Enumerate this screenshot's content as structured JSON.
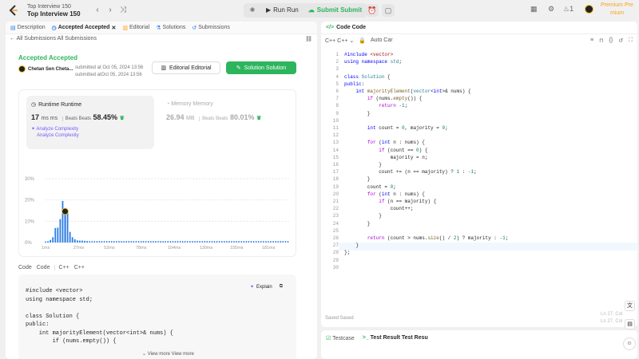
{
  "topbar": {
    "list_title": "Top Interview 150",
    "list_title2": "Top Interview 150",
    "run_label": "Run Run",
    "submit_label": "Submit Submit",
    "streak_count": "1",
    "premium_label": "Premium Pre",
    "premium_label2": "mium"
  },
  "left_tabs": [
    {
      "label": "Description"
    },
    {
      "label": "Accepted Accepted"
    },
    {
      "label": "Editorial"
    },
    {
      "label": "Solutions"
    },
    {
      "label": "Submissions"
    }
  ],
  "subbar": {
    "back_label": "All Submissions",
    "back_label2": "All Submissions"
  },
  "result": {
    "status": "Accepted Accepted",
    "author": "Chetan Sen Cheta...",
    "submitted_line1": "submitted at Oct 05, 2024 13:56",
    "submitted_line2": "submitted atOct 05, 2024 13:56",
    "editorial_btn": "Editorial  Editorial",
    "solution_btn": "Solution  Solution"
  },
  "runtime": {
    "label": "Runtime Runtime",
    "value": "17",
    "unit": "ms ms",
    "beats": "Beats Beats",
    "pct": "58.45%",
    "analyze1": "Analyze Complexity",
    "analyze2": "Analyze Complexity"
  },
  "memory": {
    "label": "Memory Memory",
    "value": "26.94",
    "unit": "MB",
    "beats": "Beats Beats",
    "pct": "80.01%"
  },
  "chart_data": {
    "type": "bar",
    "ylabel": "",
    "yticks": [
      "30%",
      "20%",
      "10%",
      "0%"
    ],
    "ylim": [
      0,
      30
    ],
    "xticks": [
      "1ms",
      "27ms",
      "52ms",
      "78ms",
      "104ms",
      "130ms",
      "155ms",
      "181ms"
    ],
    "minimap_ticks": [
      "1ms",
      "27ms",
      "52ms",
      "78ms",
      "104ms",
      "130ms",
      "155ms",
      "181ms"
    ],
    "x_range": [
      1,
      200
    ],
    "bars": [
      {
        "x": 1,
        "y": 0.5
      },
      {
        "x": 3,
        "y": 0.6
      },
      {
        "x": 5,
        "y": 1.2
      },
      {
        "x": 7,
        "y": 2.5
      },
      {
        "x": 9,
        "y": 6.8
      },
      {
        "x": 11,
        "y": 7.0
      },
      {
        "x": 13,
        "y": 11.0
      },
      {
        "x": 15,
        "y": 19.5
      },
      {
        "x": 17,
        "y": 13.5
      },
      {
        "x": 19,
        "y": 14.0
      },
      {
        "x": 21,
        "y": 5.0
      },
      {
        "x": 23,
        "y": 2.5
      },
      {
        "x": 25,
        "y": 1.5
      },
      {
        "x": 27,
        "y": 1.0
      },
      {
        "x": 29,
        "y": 0.9
      },
      {
        "x": 31,
        "y": 0.9
      },
      {
        "x": 33,
        "y": 0.8
      },
      {
        "x": 35,
        "y": 0.7
      }
    ],
    "baseline_value": 0.7,
    "highlight_x": 17
  },
  "code_tabs": [
    "Code",
    "Code",
    "C++",
    "C++"
  ],
  "code_preview": {
    "explain": "Explain",
    "view_more": "View more  View more",
    "lines": [
      "#include <vector>",
      "using namespace std;",
      "",
      "class Solution {",
      "public:",
      "    int majorityElement(vector<int>& nums) {",
      "        if (nums.empty()) {"
    ]
  },
  "editor": {
    "title": "Code Code",
    "lang": "C++ C++",
    "autosave": "Auto Car",
    "saved": "Saved  Saved",
    "cursor": "Ln 27, Col",
    "cursor2": "Ln 27, Col"
  },
  "bottom": {
    "testcase": "Testcase",
    "result": "Test Result Test Resu"
  }
}
